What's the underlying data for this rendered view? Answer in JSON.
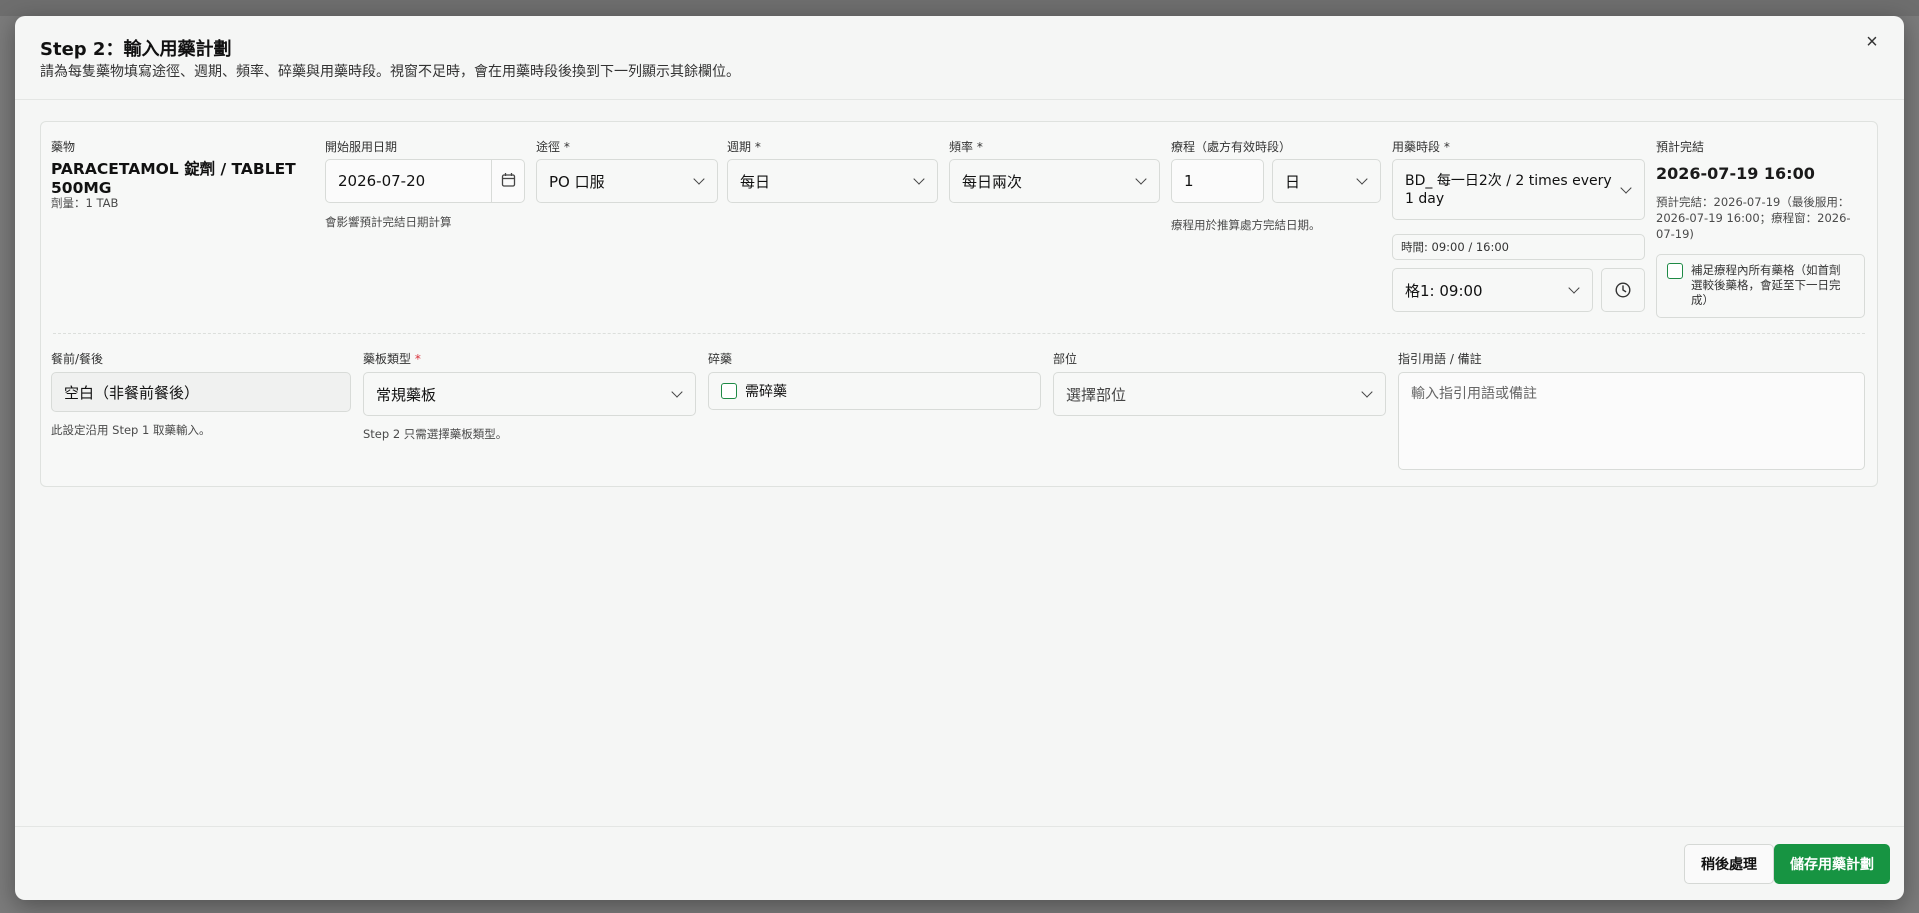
{
  "modal": {
    "title": "Step 2：輸入用藥計劃",
    "subtitle": "請為每隻藥物填寫途徑、週期、頻率、碎藥與用藥時段。視窗不足時，會在用藥時段後換到下一列顯示其餘欄位。",
    "close_icon": "×"
  },
  "drug": {
    "label": "藥物",
    "name_line1": "PARACETAMOL 錠劑 / TABLET",
    "name_line2": "500MG",
    "dose": "劑量：1 TAB"
  },
  "start_date": {
    "label": "開始服用日期",
    "value": "2026-07-20",
    "help": "會影響預計完結日期計算"
  },
  "route": {
    "label": "途徑",
    "required": "*",
    "value": "PO 口服"
  },
  "cycle": {
    "label": "週期",
    "required": "*",
    "value": "每日"
  },
  "frequency": {
    "label": "頻率",
    "required": "*",
    "value": "每日兩次"
  },
  "course": {
    "label": "療程（處方有效時段）",
    "value": "1",
    "unit": "日",
    "help": "療程用於推算處方完結日期。"
  },
  "timing": {
    "label": "用藥時段",
    "required": "*",
    "value_line1": "BD_ 每一日2次 / 2 times every",
    "value_line2": "1 day",
    "times": "時間: 09:00 / 16:00",
    "slot": "格1: 09:00"
  },
  "expected_end": {
    "label": "預計完結",
    "value": "2026-07-19 16:00",
    "detail_line1": "預計完結：2026-07-19（最後服用：",
    "detail_line2": "2026-07-19 16:00；療程窗：2026-",
    "detail_line3": "07-19)",
    "fill_line1": "補足療程內所有藥格（如首劑",
    "fill_line2": "選較後藥格，會延至下一日完",
    "fill_line3": "成）"
  },
  "meal": {
    "label": "餐前/餐後",
    "value": "空白（非餐前餐後）",
    "help": "此設定沿用 Step 1 取藥輸入。"
  },
  "board_type": {
    "label": "藥板類型",
    "required": "*",
    "value": "常規藥板",
    "help": "Step 2 只需選擇藥板類型。"
  },
  "crush": {
    "label": "碎藥",
    "checkbox_label": "需碎藥"
  },
  "site": {
    "label": "部位",
    "placeholder": "選擇部位"
  },
  "notes": {
    "label": "指引用語 / 備註",
    "placeholder": "輸入指引用語或備註"
  },
  "footer": {
    "later_label": "稍後處理",
    "save_label": "儲存用藥計劃"
  },
  "colors": {
    "accent": "#179442",
    "required": "#d9303a"
  }
}
